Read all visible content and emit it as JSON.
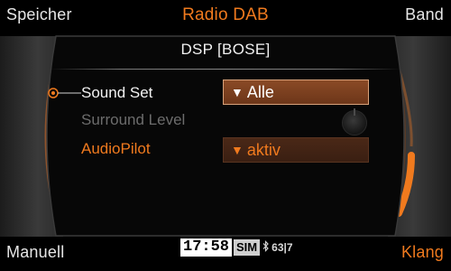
{
  "softkeys": {
    "top_left": "Speicher",
    "top_center": "Radio DAB",
    "top_right": "Band",
    "bottom_left": "Manuell",
    "bottom_right": "Klang"
  },
  "panel": {
    "title": "DSP [BOSE]",
    "rows": [
      {
        "label": "Sound Set",
        "value": "Alle",
        "state": "selected"
      },
      {
        "label": "Surround Level",
        "state": "disabled"
      },
      {
        "label": "AudioPilot",
        "value": "aktiv",
        "state": "active"
      }
    ]
  },
  "status": {
    "time": "17:58",
    "sim": "SIM",
    "bluetooth_icon": "bluetooth-icon",
    "signal": "63|7"
  },
  "colors": {
    "accent": "#f07a1e",
    "selected_fill": "#7a3f1f",
    "disabled_text": "#6c6c6c"
  }
}
